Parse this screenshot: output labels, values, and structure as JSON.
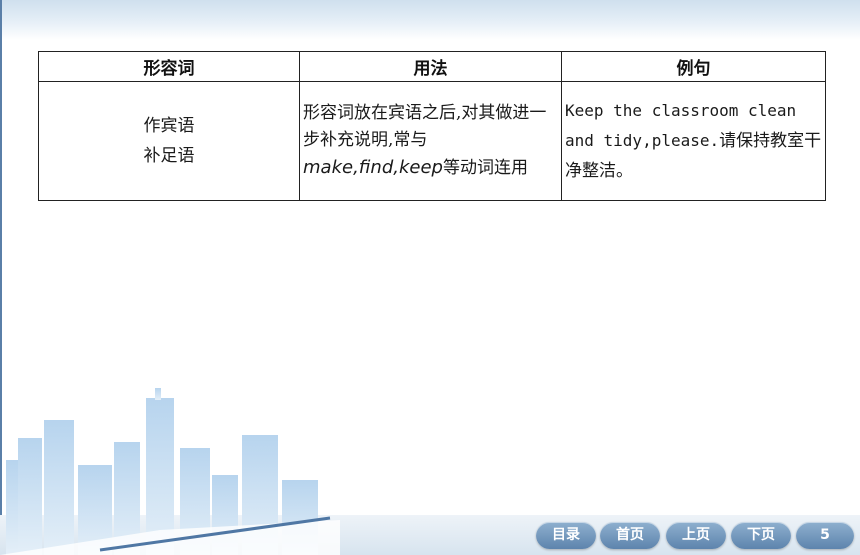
{
  "table": {
    "headers": [
      "形容词",
      "用法",
      "例句"
    ],
    "row": {
      "role_lines": [
        "作宾语",
        "补足语"
      ],
      "usage_before": "形容词放在宾语之后,对其做进一步补充说明,常与",
      "usage_verbs": "make,find,keep",
      "usage_after": "等动词连用",
      "example_en": "Keep the classroom clean and tidy,please.",
      "example_zh": "请保持教室干净整洁。"
    }
  },
  "nav": {
    "contents": "目录",
    "home": "首页",
    "prev": "上页",
    "next": "下页",
    "page": "5"
  },
  "colors": {
    "nav_button": "#6f94ba",
    "skyline": "#9ec3e6",
    "frame_rule": "#5a7fa8"
  }
}
